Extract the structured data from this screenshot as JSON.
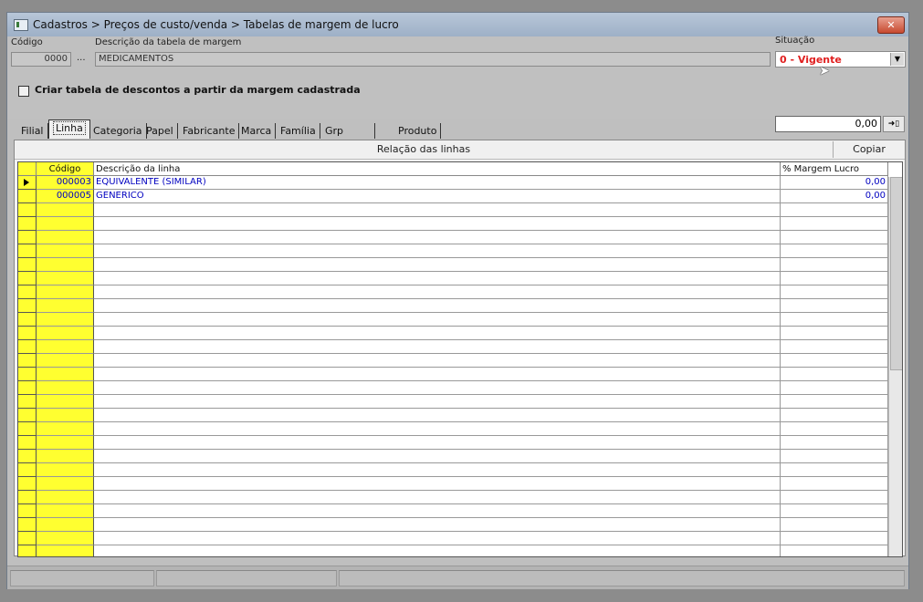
{
  "window": {
    "title": "Cadastros > Preços de custo/venda > Tabelas de margem de lucro",
    "close_label": "✕"
  },
  "header": {
    "codigo_label": "Código",
    "codigo_value": "0000",
    "lookup_button": "...",
    "descricao_label": "Descrição da tabela de margem",
    "descricao_value": "MEDICAMENTOS",
    "situacao_label": "Situação",
    "situacao_value": "0 - Vigente",
    "checkbox_label": "Criar tabela de descontos a partir da margem cadastrada",
    "accent_color": "#e02020"
  },
  "tabs": [
    {
      "label": "Filial"
    },
    {
      "label": "Linha"
    },
    {
      "label": "Categoria"
    },
    {
      "label": "Papel"
    },
    {
      "label": "Fabricante"
    },
    {
      "label": "Marca"
    },
    {
      "label": "Família"
    },
    {
      "label": "Grp desconto"
    },
    {
      "label": "Produto"
    }
  ],
  "active_tab": "Linha",
  "value_input": "0,00",
  "panel": {
    "title": "Relação das linhas",
    "copy_button": "Copiar",
    "columns": {
      "codigo": "Código",
      "descricao": "Descrição da linha",
      "margem": "% Margem Lucro"
    },
    "rows": [
      {
        "codigo": "000003",
        "descricao": "EQUIVALENTE (SIMILAR)",
        "margem": "0,00"
      },
      {
        "codigo": "000005",
        "descricao": "GENERICO",
        "margem": "0,00"
      }
    ]
  }
}
